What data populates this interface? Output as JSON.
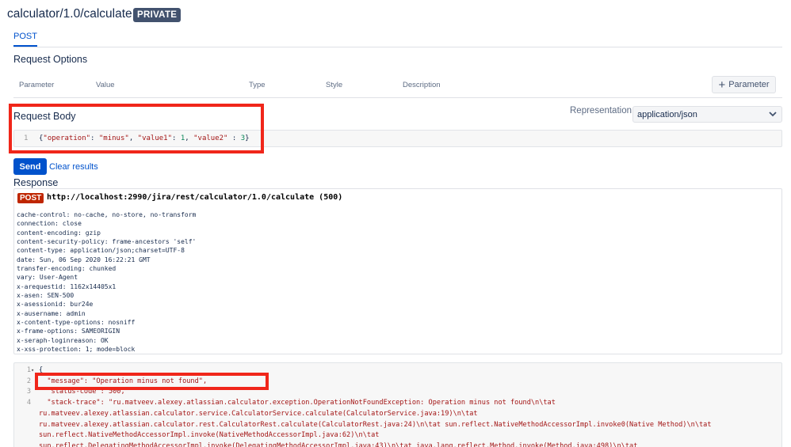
{
  "header": {
    "title": "calculator/1.0/calculate",
    "badge": "PRIVATE"
  },
  "tabs": [
    {
      "label": "POST"
    }
  ],
  "request_options": {
    "heading": "Request Options",
    "columns": [
      "Parameter",
      "Value",
      "Type",
      "Style",
      "Description"
    ],
    "add_button": "Parameter"
  },
  "request_body": {
    "heading": "Request Body",
    "representation_label": "Representation",
    "representation_value": "application/json",
    "line_number": "1",
    "code": {
      "open": "{",
      "k1": "\"operation\"",
      "v1": "\"minus\"",
      "k2": "\"value1\"",
      "v2": "1",
      "k3": "\"value2\"",
      "v3": "3",
      "close": "}"
    }
  },
  "actions": {
    "send": "Send",
    "clear": "Clear results"
  },
  "response": {
    "heading": "Response",
    "method": "POST",
    "url_line": "http://localhost:2990/jira/rest/calculator/1.0/calculate (500)",
    "headers": [
      "cache-control: no-cache, no-store, no-transform",
      "connection: close",
      "content-encoding: gzip",
      "content-security-policy: frame-ancestors 'self'",
      "content-type: application/json;charset=UTF-8",
      "date: Sun, 06 Sep 2020 16:22:21 GMT",
      "transfer-encoding: chunked",
      "vary: User-Agent",
      "x-arequestid: 1162x14405x1",
      "x-asen: SEN-500",
      "x-asessionid: bur24e",
      "x-ausername: admin",
      "x-content-type-options: nosniff",
      "x-frame-options: SAMEORIGIN",
      "x-seraph-loginreason: OK",
      "x-xss-protection: 1; mode=block"
    ],
    "body_lines": [
      {
        "num": "1",
        "text": "{"
      },
      {
        "num": "2",
        "text": "  \"message\": \"Operation minus not found\","
      },
      {
        "num": "3",
        "text": "  \"status-code\": 500,"
      },
      {
        "num": "4",
        "text": "  \"stack-trace\": \"ru.matveev.alexey.atlassian.calculator.exception.OperationNotFoundException: Operation minus not found\\n\\tat"
      },
      {
        "num": "",
        "text": "ru.matveev.alexey.atlassian.calculator.service.CalculatorService.calculate(CalculatorService.java:19)\\n\\tat"
      },
      {
        "num": "",
        "text": "ru.matveev.alexey.atlassian.calculator.rest.CalculatorRest.calculate(CalculatorRest.java:24)\\n\\tat sun.reflect.NativeMethodAccessorImpl.invoke0(Native Method)\\n\\tat"
      },
      {
        "num": "",
        "text": "sun.reflect.NativeMethodAccessorImpl.invoke(NativeMethodAccessorImpl.java:62)\\n\\tat"
      },
      {
        "num": "",
        "text": "sun.reflect.DelegatingMethodAccessorImpl.invoke(DelegatingMethodAccessorImpl.java:43)\\n\\tat java.lang.reflect.Method.invoke(Method.java:498)\\n\\tat"
      }
    ]
  },
  "colors": {
    "accent": "#0052cc",
    "highlight_box": "#f0261a",
    "post_badge": "#bf2600",
    "badge_bg": "#42526e"
  }
}
